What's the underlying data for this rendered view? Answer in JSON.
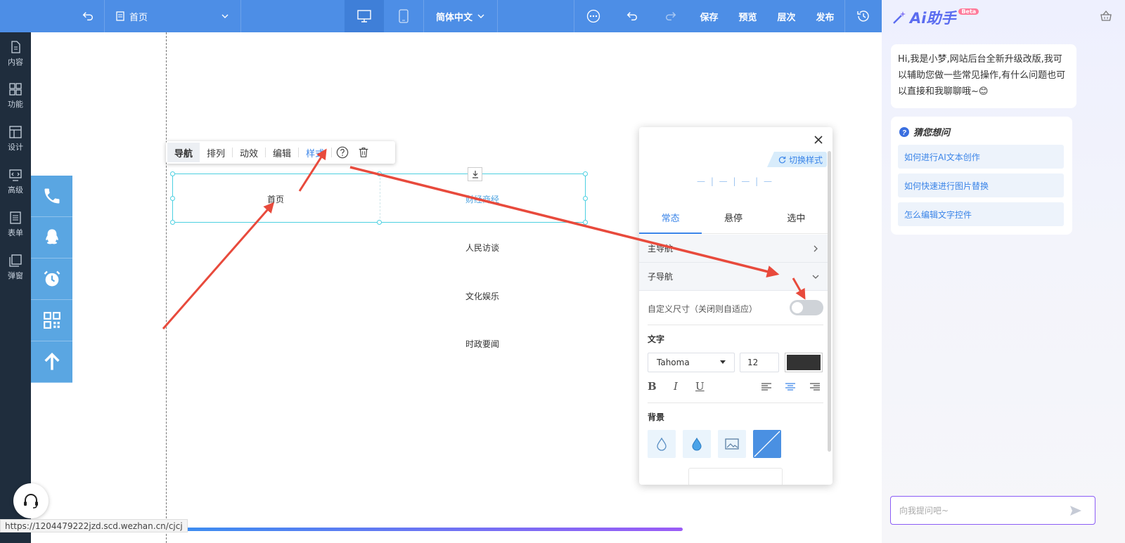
{
  "topbar": {
    "page_name": "首页",
    "language": "简体中文",
    "save": "保存",
    "preview": "预览",
    "layers": "层次",
    "publish": "发布"
  },
  "sidebar": {
    "items": [
      {
        "label": "内容",
        "icon": "document-icon"
      },
      {
        "label": "功能",
        "icon": "grid-icon"
      },
      {
        "label": "设计",
        "icon": "layout-icon"
      },
      {
        "label": "高级",
        "icon": "code-monitor-icon"
      },
      {
        "label": "表单",
        "icon": "form-icon"
      },
      {
        "label": "弹窗",
        "icon": "popup-icon"
      }
    ]
  },
  "float_bar": {
    "buttons": [
      "phone-icon",
      "qq-icon",
      "alarm-clock-icon",
      "qrcode-icon",
      "arrow-up-icon"
    ]
  },
  "toolbar": {
    "nav": "导航",
    "arrange": "排列",
    "animation": "动效",
    "edit": "编辑",
    "style": "样式"
  },
  "nav_items": [
    "首页",
    "财经商经",
    "人民访谈",
    "文化娱乐",
    "时政要闻"
  ],
  "panel": {
    "switch_style": "切换样式",
    "preview_text": "— | — | — | —",
    "tabs": [
      "常态",
      "悬停",
      "选中"
    ],
    "main_nav": "主导航",
    "sub_nav": "子导航",
    "custom_size": "自定义尺寸（关闭则自适应）",
    "text_heading": "文字",
    "font": "Tahoma",
    "font_size": "12",
    "text_color": "#333333",
    "bold": "B",
    "italic": "I",
    "underline": "U",
    "bg_heading": "背景"
  },
  "ai": {
    "title": "Ai助手",
    "beta": "Beta",
    "greeting": "Hi,我是小梦,网站后台全新升级改版,我可以辅助您做一些常见操作,有什么问题也可以直接和我聊聊哦~😊",
    "guess_title": "猜您想问",
    "questions": [
      "如何进行AI文本创作",
      "如何快速进行图片替换",
      "怎么编辑文字控件"
    ],
    "input_placeholder": "向我提问吧~"
  },
  "status": {
    "url": "https://1204479222jzd.scd.wezhan.cn/cjcj"
  },
  "colors": {
    "topbar": "#4d8ee6",
    "sidebar": "#1f2d3d",
    "accent": "#3a84e8",
    "float_bar": "#5aa6e2",
    "annotation_arrow": "#e84a3c"
  }
}
